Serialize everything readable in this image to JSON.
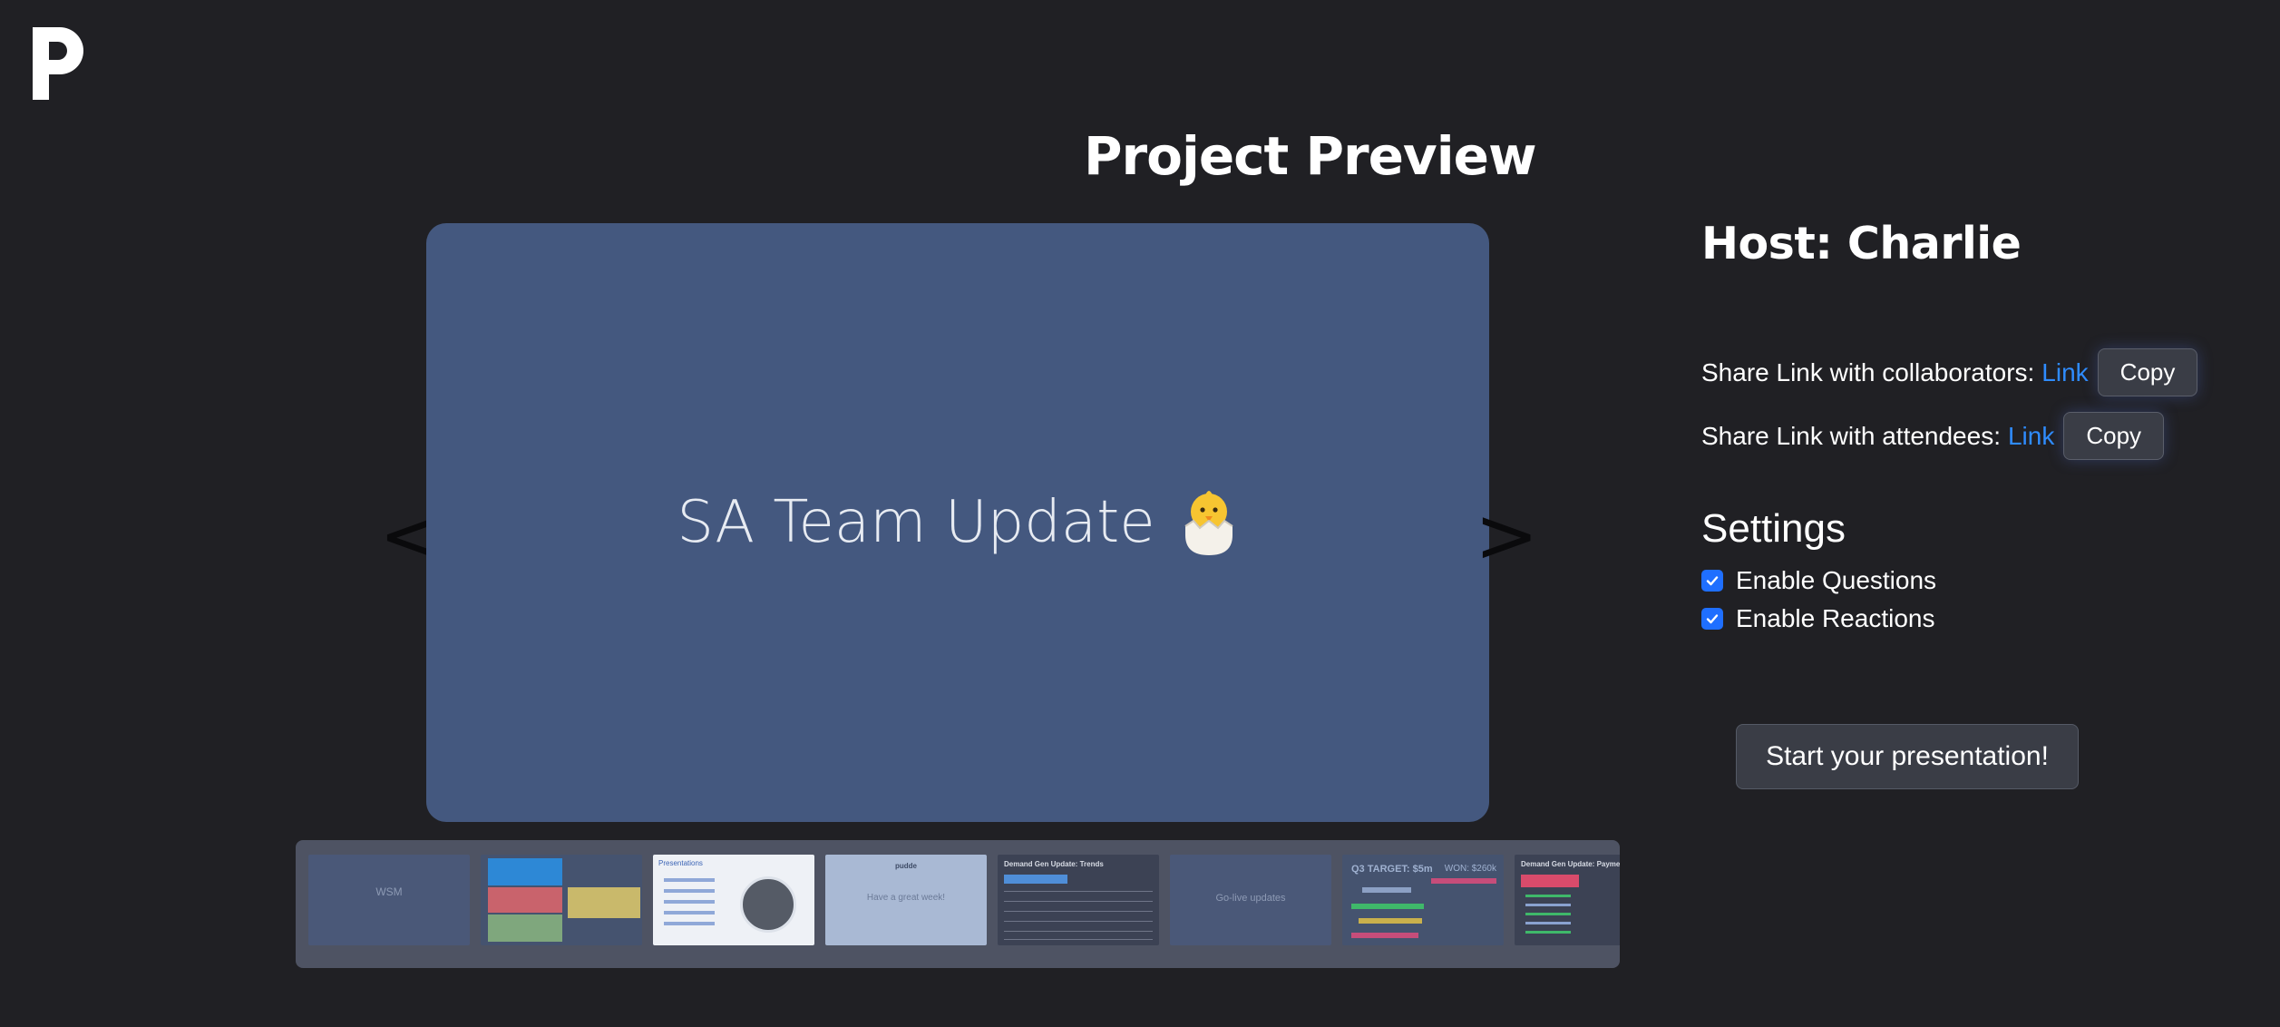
{
  "app": {
    "logo_icon": "p-logo-icon"
  },
  "page": {
    "title": "Project Preview"
  },
  "slide": {
    "title": "SA Team Update",
    "emoji_icon": "hatching-chick-icon",
    "background": "#44587f",
    "prev_label": "<",
    "next_label": ">"
  },
  "thumbnails": [
    {
      "title": "WSM",
      "subtitle": "",
      "bg": "#4a5878"
    },
    {
      "title": "",
      "subtitle": "",
      "bg": "#45536f"
    },
    {
      "title": "Presentations",
      "subtitle": "",
      "bg": "#eef1f6"
    },
    {
      "title": "pudde",
      "subtitle": "Have a great week!",
      "bg": "#a9b9d4"
    },
    {
      "title": "Demand Gen Update: Trends",
      "subtitle": "",
      "bg": "#3c4254"
    },
    {
      "title": "Go-live updates",
      "subtitle": "",
      "bg": "#4a5878"
    },
    {
      "title": "Q3 TARGET: $5m",
      "subtitle": "WON: $260k",
      "bg": "#45536f"
    },
    {
      "title": "Demand Gen Update: Payment Acc",
      "subtitle": "",
      "bg": "#3c4254"
    }
  ],
  "host": {
    "label": "Host: Charlie"
  },
  "share": {
    "collaborators_label": "Share Link with collaborators:",
    "attendees_label": "Share Link with attendees:",
    "link_label": "Link",
    "copy_label": "Copy"
  },
  "settings": {
    "title": "Settings",
    "options": [
      {
        "label": "Enable Questions",
        "checked": true
      },
      {
        "label": "Enable Reactions",
        "checked": true
      }
    ]
  },
  "start_button": {
    "label": "Start your presentation!"
  },
  "colors": {
    "background": "#202024",
    "accent_link": "#2f8cff",
    "checkbox": "#1f6fff"
  }
}
